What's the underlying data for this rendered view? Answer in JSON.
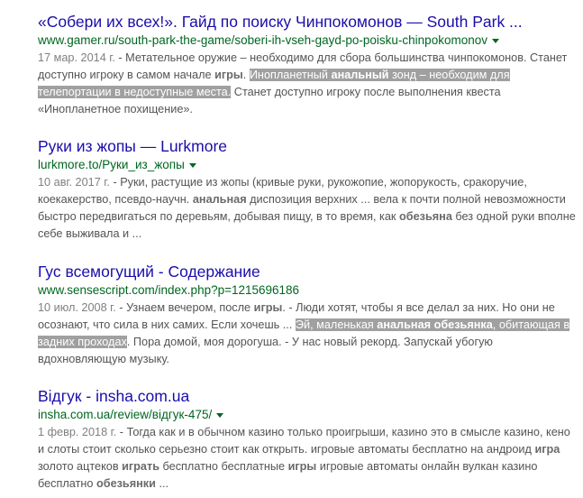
{
  "results": [
    {
      "title": "«Собери их всех!». Гайд по поиску Чинпокомонов — South Park ...",
      "url": "www.gamer.ru/south-park-the-game/soberi-ih-vseh-gayd-po-poisku-chinpokomonov",
      "date": "17 мар. 2014 г.",
      "sep": " - ",
      "s1": "Метательное оружие – необходимо для сбора большинства чинпокомонов. Станет доступно игроку в самом начале ",
      "b1": "игры",
      "s2": ". ",
      "hl1": "Инопланетный ",
      "hlb1": "анальный",
      "hl2": " зонд – необходим для телепортации в недоступные места.",
      "s3": " Станет доступно игроку после выполнения квеста «Инопланетное похищение»."
    },
    {
      "title": "Руки из жопы — Lurkmore",
      "url": "lurkmore.to/Руки_из_жопы",
      "date": "10 авг. 2017 г.",
      "sep": " - ",
      "s1": "Руки, растущие из жопы (кривые руки, рукожопие, жопорукость, сракоручие, коекакерство, псевдо-научн. ",
      "b1": "анальная",
      "s2": " диспозиция верхних ... вела к почти полной невозможности быстро передвигаться по деревьям, добывая пищу, в то время, как ",
      "b2": "обезьяна",
      "s3": " без одной руки вполне себе выживала и ..."
    },
    {
      "title": "Гус всемогущий - Содержание",
      "url": "www.sensescript.com/index.php?p=1215696186",
      "date": "10 июл. 2008 г.",
      "sep": " - ",
      "s1": "Узнаем вечером, после ",
      "b1": "игры",
      "s2": ". - Люди хотят, чтобы я все делал за них. Но они не осознают, что сила в них самих. Если хочешь ... ",
      "hl1": "Эй, маленькая ",
      "hlb1": "анальная обезьянка",
      "hl2": ", обитающая в задних проходах",
      "s3": ". Пора домой, моя дорогуша. - У нас новый рекорд. Запускай убогую вдохновляющую музыку."
    },
    {
      "title": "Відгук - insha.com.ua",
      "url": "insha.com.ua/review/відгук-475/",
      "date": "1 февр. 2018 г.",
      "sep": " - ",
      "s1": "Тогда как и в обычном казино только проигрыши, казино это в смысле казино, кено и слоты стоит сколько серьезно стоит как открыть. игровые автоматы бесплатно на андроид ",
      "b1": "игра",
      "s2": " золото ацтеков ",
      "b2": "играть",
      "s3": " бесплатно бесплатные ",
      "b3": "игры",
      "s4": " игровые автоматы онлайн вулкан казино бесплатно ",
      "b4": "обезьянки",
      "s5": " ..."
    }
  ]
}
